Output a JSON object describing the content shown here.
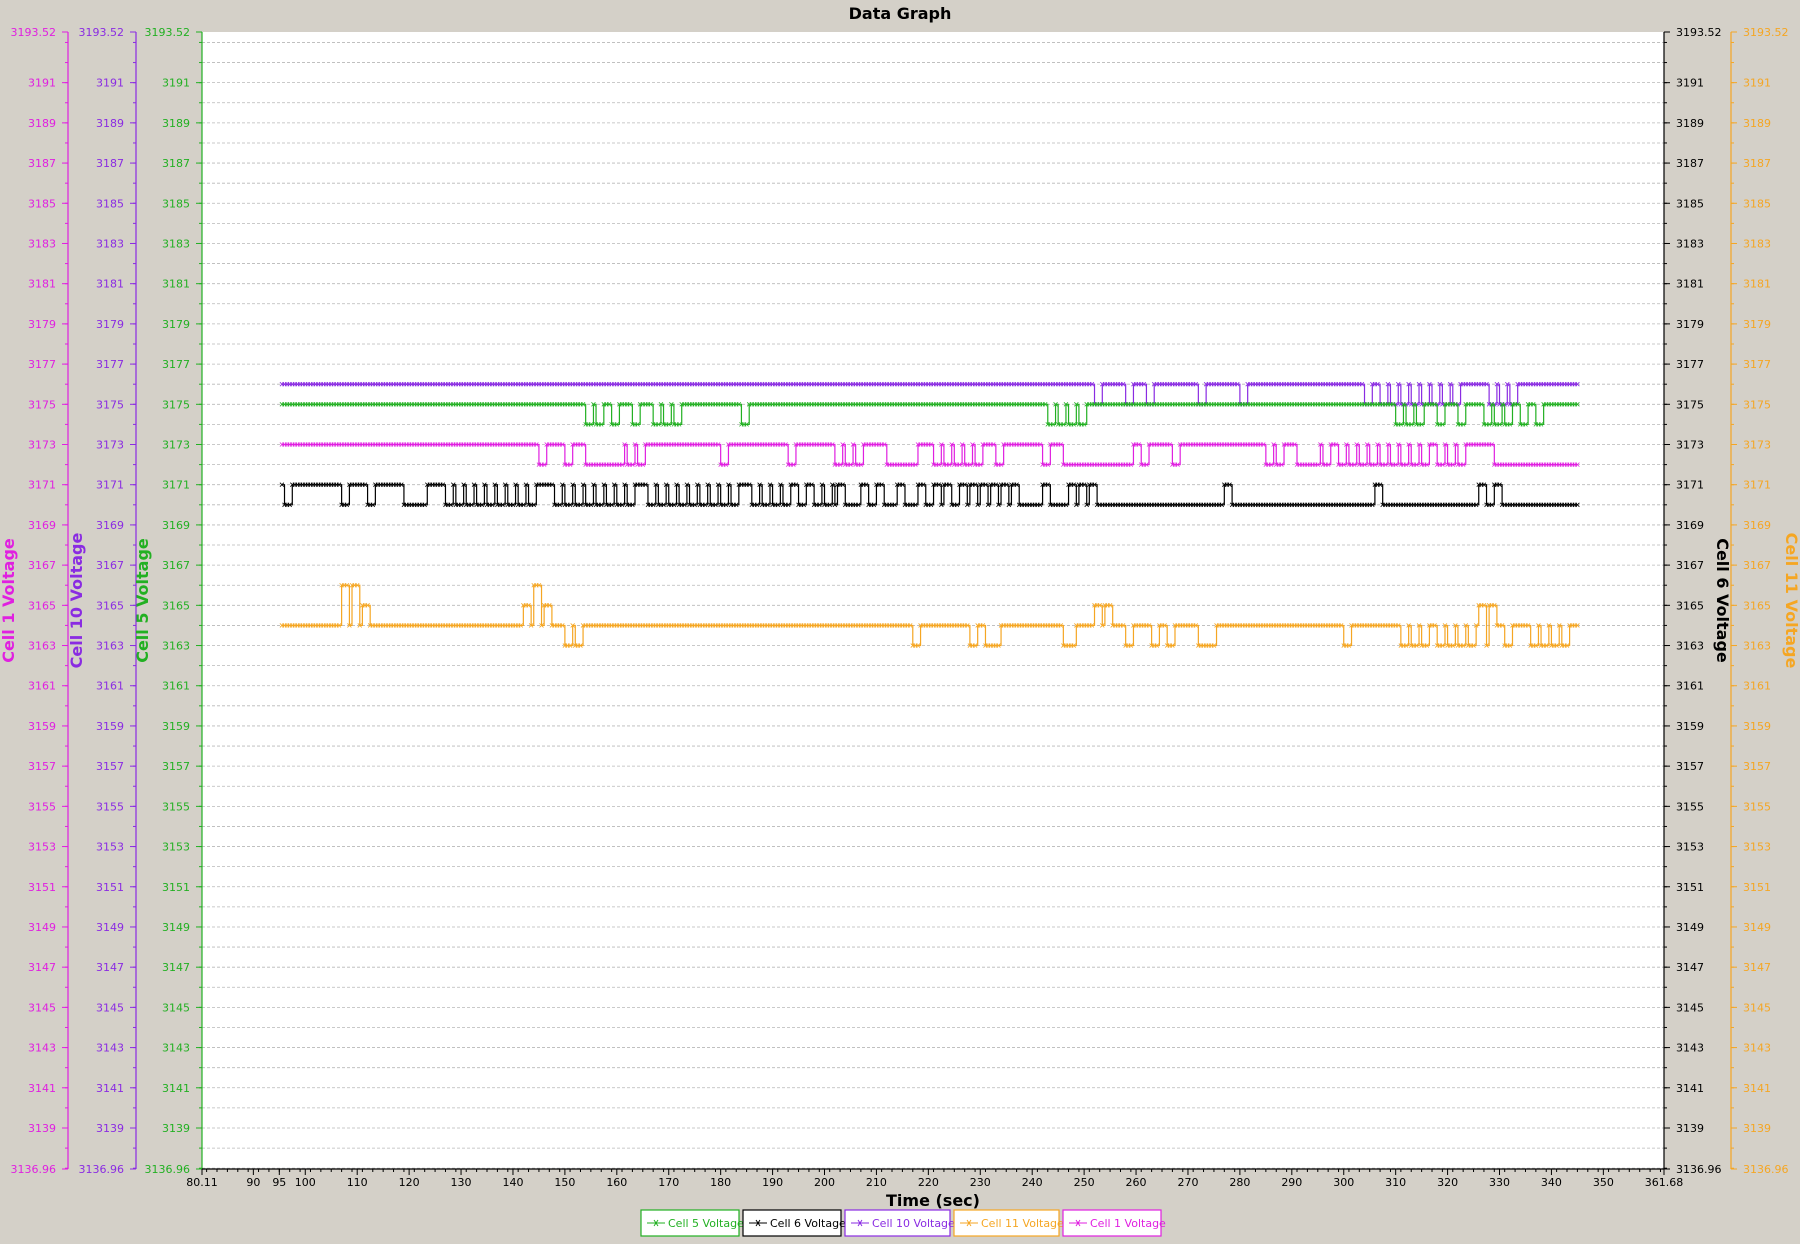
{
  "chart_data": {
    "type": "line",
    "title": "Data Graph",
    "xlabel": "Time (sec)",
    "xlim": [
      80.11,
      361.68
    ],
    "ylim": [
      3136.96,
      3193.52
    ],
    "x_tick_labels": [
      "80.11",
      "90",
      "95",
      "100",
      "110",
      "120",
      "130",
      "140",
      "150",
      "160",
      "170",
      "180",
      "190",
      "200",
      "210",
      "220",
      "230",
      "240",
      "250",
      "260",
      "270",
      "280",
      "290",
      "300",
      "310",
      "320",
      "330",
      "340",
      "350",
      "361.68"
    ],
    "y_tick_labels": [
      "3136.96",
      "3139",
      "3141",
      "3143",
      "3145",
      "3147",
      "3149",
      "3151",
      "3153",
      "3155",
      "3157",
      "3159",
      "3161",
      "3163",
      "3165",
      "3167",
      "3169",
      "3171",
      "3173",
      "3175",
      "3177",
      "3179",
      "3181",
      "3183",
      "3185",
      "3187",
      "3189",
      "3191",
      "3193.52"
    ],
    "grid": true,
    "legend_position": "bottom",
    "axes": [
      {
        "label": "Cell 1 Voltage",
        "side": "left",
        "color": "#e020e0"
      },
      {
        "label": "Cell 10 Voltage",
        "side": "left",
        "color": "#8a2be2"
      },
      {
        "label": "Cell 5 Voltage",
        "side": "left",
        "color": "#22b022"
      },
      {
        "label": "Cell 6 Voltage",
        "side": "right",
        "color": "#000000"
      },
      {
        "label": "Cell 11 Voltage",
        "side": "right",
        "color": "#f5a623"
      }
    ],
    "series": [
      {
        "name": "Cell 10 Voltage",
        "color": "#8a2be2",
        "base": 3176,
        "alt": 3175,
        "x_start": 95.5,
        "x_end": 345,
        "dips": [
          [
            252,
            253
          ],
          [
            258,
            259
          ],
          [
            262,
            263
          ],
          [
            272,
            273
          ],
          [
            280,
            281
          ],
          [
            304,
            305
          ],
          [
            307,
            308
          ],
          [
            309,
            310
          ],
          [
            311,
            312
          ],
          [
            313,
            314
          ],
          [
            315,
            316
          ],
          [
            317,
            318
          ],
          [
            319,
            320
          ],
          [
            321,
            322
          ],
          [
            328,
            329
          ],
          [
            330,
            331
          ],
          [
            332,
            333
          ]
        ]
      },
      {
        "name": "Cell 5 Voltage",
        "color": "#22b022",
        "base": 3175,
        "alt": 3174,
        "x_start": 95.5,
        "x_end": 345,
        "dips": [
          [
            154,
            155
          ],
          [
            156,
            157
          ],
          [
            159,
            160
          ],
          [
            163,
            164
          ],
          [
            167,
            168
          ],
          [
            169,
            170
          ],
          [
            171,
            172
          ],
          [
            184,
            185
          ],
          [
            243,
            244
          ],
          [
            245,
            246
          ],
          [
            247,
            248
          ],
          [
            249,
            250
          ],
          [
            310,
            311
          ],
          [
            312,
            313
          ],
          [
            314,
            315
          ],
          [
            318,
            319
          ],
          [
            322,
            323
          ],
          [
            327,
            328
          ],
          [
            329,
            330
          ],
          [
            331,
            332
          ],
          [
            334,
            335
          ],
          [
            337,
            338
          ]
        ]
      },
      {
        "name": "Cell 1 Voltage",
        "color": "#e020e0",
        "base": 3173,
        "alt": 3172,
        "x_start": 95.5,
        "x_end": 345,
        "dips": [
          [
            145,
            146
          ],
          [
            150,
            151
          ],
          [
            154,
            155
          ],
          [
            155.5,
            156.5
          ],
          [
            157,
            158
          ],
          [
            158.5,
            159.5
          ],
          [
            160,
            161
          ],
          [
            162,
            163
          ],
          [
            164,
            165
          ],
          [
            180,
            181
          ],
          [
            193,
            194
          ],
          [
            202,
            203
          ],
          [
            204,
            205
          ],
          [
            206,
            207
          ],
          [
            212,
            213
          ],
          [
            213.5,
            214.5
          ],
          [
            215,
            216
          ],
          [
            216.5,
            217.5
          ],
          [
            221,
            222
          ],
          [
            223,
            224
          ],
          [
            225,
            226
          ],
          [
            227,
            228
          ],
          [
            229,
            230
          ],
          [
            233,
            234
          ],
          [
            242,
            243
          ],
          [
            246,
            259
          ],
          [
            261,
            262
          ],
          [
            267,
            268
          ],
          [
            285,
            286
          ],
          [
            287,
            288
          ],
          [
            291,
            292
          ],
          [
            292.5,
            293.5
          ],
          [
            294,
            295
          ],
          [
            296,
            297
          ],
          [
            299,
            300
          ],
          [
            301,
            302
          ],
          [
            303,
            304
          ],
          [
            305,
            306
          ],
          [
            307,
            308
          ],
          [
            309,
            310
          ],
          [
            311,
            312
          ],
          [
            313,
            314
          ],
          [
            315,
            316
          ],
          [
            318,
            319
          ],
          [
            320,
            321
          ],
          [
            322,
            323
          ],
          [
            329,
            345
          ]
        ]
      },
      {
        "name": "Cell 6 Voltage",
        "color": "#000000",
        "base": 3171,
        "alt": 3170,
        "x_start": 95.5,
        "x_end": 345,
        "dips": [
          [
            96,
            97
          ],
          [
            107,
            108
          ],
          [
            112,
            113
          ],
          [
            119,
            120
          ],
          [
            120.5,
            121.5
          ],
          [
            122,
            123
          ],
          [
            127,
            128
          ],
          [
            129,
            130
          ],
          [
            131,
            132
          ],
          [
            133,
            134
          ],
          [
            135,
            136
          ],
          [
            137,
            138
          ],
          [
            139,
            140
          ],
          [
            141,
            142
          ],
          [
            143,
            144
          ],
          [
            148,
            149
          ],
          [
            150,
            151
          ],
          [
            152,
            153
          ],
          [
            154,
            155
          ],
          [
            156,
            157
          ],
          [
            158,
            159
          ],
          [
            160,
            161
          ],
          [
            162,
            163
          ],
          [
            166,
            167
          ],
          [
            168,
            169
          ],
          [
            170,
            171
          ],
          [
            172,
            173
          ],
          [
            174,
            175
          ],
          [
            176,
            177
          ],
          [
            178,
            179
          ],
          [
            180,
            181
          ],
          [
            182,
            183
          ],
          [
            186,
            187
          ],
          [
            188,
            189
          ],
          [
            190,
            191
          ],
          [
            192,
            193
          ],
          [
            195,
            196
          ],
          [
            198,
            199
          ],
          [
            200,
            201
          ],
          [
            202,
            346
          ],
          [
            277,
            278
          ],
          [
            306,
            307
          ],
          [
            326,
            327
          ],
          [
            329,
            330
          ]
        ],
        "ups": [
          [
            202.5,
            203.5
          ],
          [
            207,
            208
          ],
          [
            210,
            211
          ],
          [
            214,
            215
          ],
          [
            218,
            219
          ],
          [
            221,
            222
          ],
          [
            223,
            224
          ],
          [
            226,
            227
          ],
          [
            228,
            229
          ],
          [
            230,
            231
          ],
          [
            232,
            233
          ],
          [
            234,
            235
          ],
          [
            236,
            237
          ],
          [
            242,
            243
          ],
          [
            247,
            248
          ],
          [
            249,
            250
          ],
          [
            251,
            252
          ],
          [
            277,
            278
          ],
          [
            306,
            307
          ],
          [
            326,
            327
          ],
          [
            329,
            330
          ]
        ]
      },
      {
        "name": "Cell 11 Voltage",
        "color": "#f5a623",
        "base": 3164,
        "alt": 3163,
        "x_start": 95.5,
        "x_end": 345,
        "ups": [
          [
            107,
            108,
            3166
          ],
          [
            109,
            110,
            3166
          ],
          [
            111,
            112,
            3165
          ],
          [
            142,
            143,
            3165
          ],
          [
            144,
            145,
            3166
          ],
          [
            146,
            147,
            3165
          ],
          [
            252,
            253,
            3165
          ],
          [
            254,
            255,
            3165
          ],
          [
            326,
            327,
            3165
          ],
          [
            328,
            329,
            3165
          ]
        ],
        "dips": [
          [
            150,
            151
          ],
          [
            152,
            153
          ],
          [
            217,
            218
          ],
          [
            228,
            229
          ],
          [
            231,
            232
          ],
          [
            232.5,
            233.5
          ],
          [
            246,
            248
          ],
          [
            258,
            259
          ],
          [
            263,
            264
          ],
          [
            266,
            267
          ],
          [
            272,
            275
          ],
          [
            300,
            301
          ],
          [
            311,
            312
          ],
          [
            313,
            314
          ],
          [
            315,
            316
          ],
          [
            318,
            319
          ],
          [
            320,
            321
          ],
          [
            322,
            323
          ],
          [
            324,
            325
          ],
          [
            327,
            328
          ],
          [
            331,
            332
          ],
          [
            336,
            337
          ],
          [
            338,
            339
          ],
          [
            340,
            341
          ],
          [
            342,
            343
          ]
        ]
      }
    ]
  }
}
